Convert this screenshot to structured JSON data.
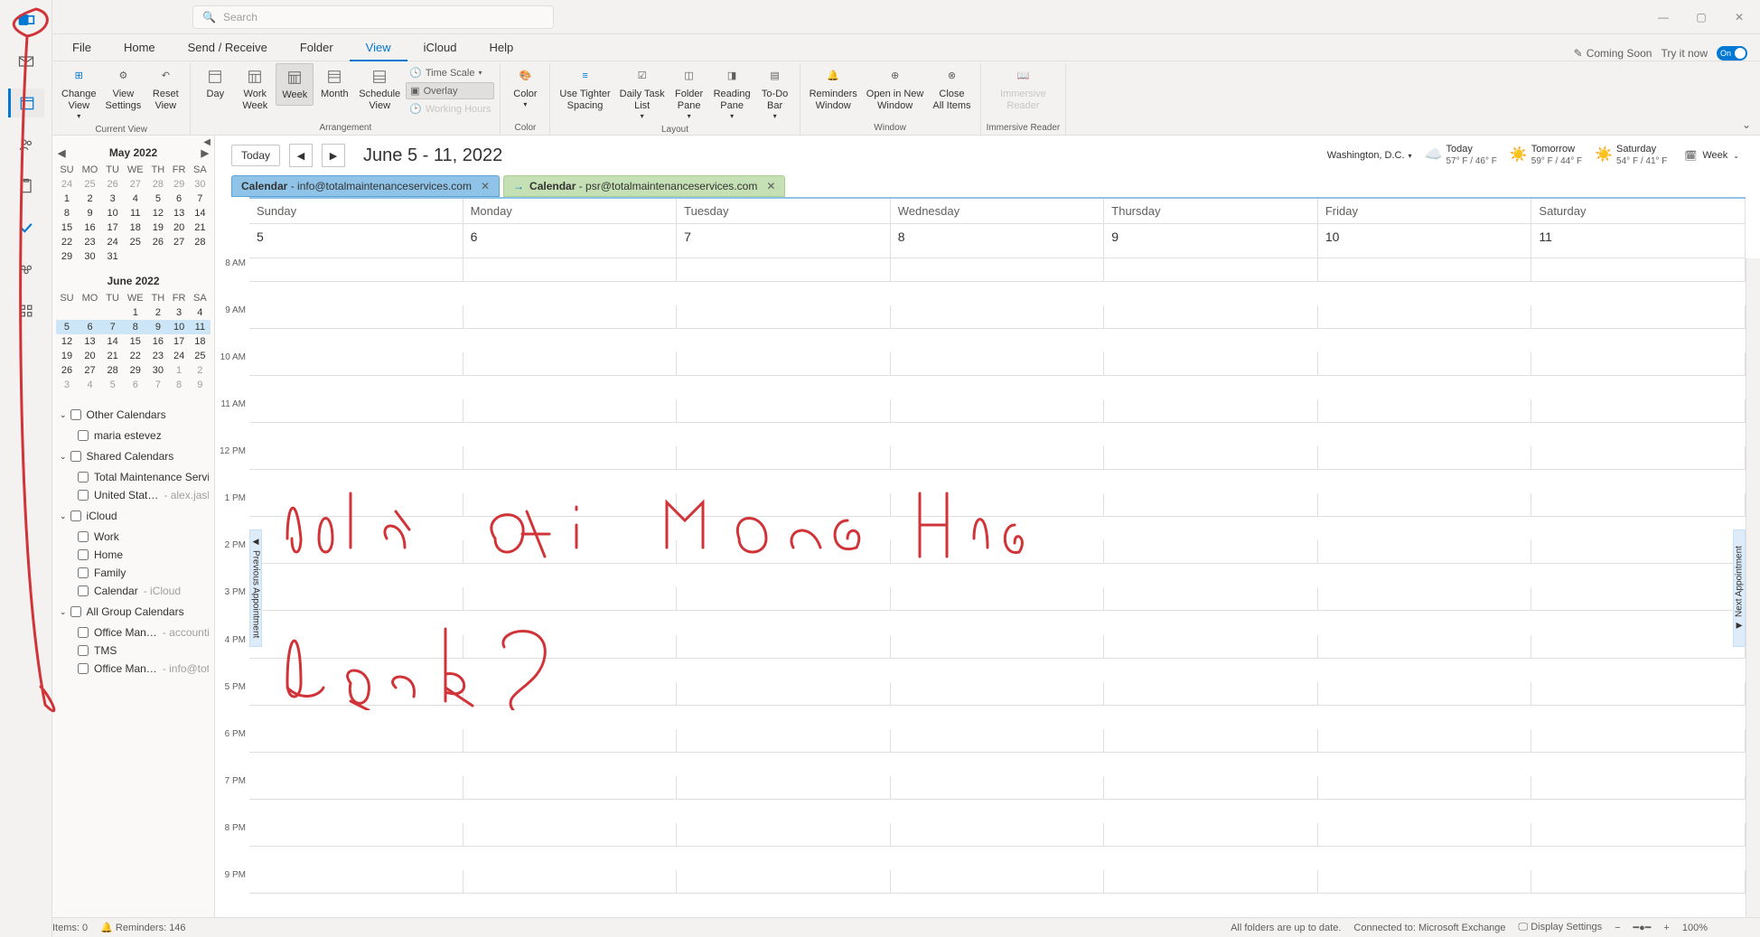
{
  "titlebar": {
    "search_placeholder": "Search"
  },
  "menubar": {
    "items": [
      "File",
      "Home",
      "Send / Receive",
      "Folder",
      "View",
      "iCloud",
      "Help"
    ],
    "active_index": 4,
    "coming_soon": "Coming Soon",
    "try_it_now": "Try it now",
    "toggle_label": "On"
  },
  "ribbon": {
    "groups": {
      "current_view": {
        "label": "Current View",
        "change_view": "Change\nView",
        "view_settings": "View\nSettings",
        "reset_view": "Reset\nView"
      },
      "arrangement": {
        "label": "Arrangement",
        "day": "Day",
        "work_week": "Work\nWeek",
        "week": "Week",
        "month": "Month",
        "schedule_view": "Schedule\nView",
        "time_scale": "Time Scale",
        "overlay": "Overlay",
        "working_hours": "Working Hours"
      },
      "color": {
        "label": "Color",
        "color": "Color"
      },
      "layout": {
        "label": "Layout",
        "tighter_spacing": "Use Tighter\nSpacing",
        "daily_task": "Daily Task\nList",
        "folder_pane": "Folder\nPane",
        "reading_pane": "Reading\nPane",
        "todo_bar": "To-Do\nBar"
      },
      "window": {
        "label": "Window",
        "reminders": "Reminders\nWindow",
        "open_new": "Open in New\nWindow",
        "close_all": "Close\nAll Items"
      },
      "immersive": {
        "label": "Immersive Reader",
        "reader": "Immersive\nReader"
      }
    }
  },
  "nav_rail": {
    "items": [
      {
        "name": "outlook-brand",
        "glyph": "brand"
      },
      {
        "name": "mail",
        "glyph": "mail"
      },
      {
        "name": "calendar",
        "glyph": "calendar",
        "active": true
      },
      {
        "name": "people",
        "glyph": "people"
      },
      {
        "name": "tasks",
        "glyph": "clipboard"
      },
      {
        "name": "todo",
        "glyph": "check"
      },
      {
        "name": "groups",
        "glyph": "group"
      },
      {
        "name": "more",
        "glyph": "grid"
      }
    ]
  },
  "mini_cal": {
    "month1": {
      "title": "May 2022",
      "dow": [
        "SU",
        "MO",
        "TU",
        "WE",
        "TH",
        "FR",
        "SA"
      ],
      "weeks": [
        [
          {
            "d": 24,
            "dim": true
          },
          {
            "d": 25,
            "dim": true
          },
          {
            "d": 26,
            "dim": true
          },
          {
            "d": 27,
            "dim": true
          },
          {
            "d": 28,
            "dim": true
          },
          {
            "d": 29,
            "dim": true
          },
          {
            "d": 30,
            "dim": true
          }
        ],
        [
          {
            "d": 1
          },
          {
            "d": 2
          },
          {
            "d": 3
          },
          {
            "d": 4
          },
          {
            "d": 5
          },
          {
            "d": 6
          },
          {
            "d": 7
          }
        ],
        [
          {
            "d": 8
          },
          {
            "d": 9
          },
          {
            "d": 10
          },
          {
            "d": 11
          },
          {
            "d": 12
          },
          {
            "d": 13
          },
          {
            "d": 14
          }
        ],
        [
          {
            "d": 15
          },
          {
            "d": 16
          },
          {
            "d": 17
          },
          {
            "d": 18
          },
          {
            "d": 19
          },
          {
            "d": 20
          },
          {
            "d": 21
          }
        ],
        [
          {
            "d": 22
          },
          {
            "d": 23
          },
          {
            "d": 24
          },
          {
            "d": 25
          },
          {
            "d": 26
          },
          {
            "d": 27
          },
          {
            "d": 28
          }
        ],
        [
          {
            "d": 29
          },
          {
            "d": 30
          },
          {
            "d": 31
          },
          {
            "d": "",
            "dim": true
          },
          {
            "d": "",
            "dim": true
          },
          {
            "d": "",
            "dim": true
          },
          {
            "d": "",
            "dim": true
          }
        ]
      ]
    },
    "month2": {
      "title": "June 2022",
      "dow": [
        "SU",
        "MO",
        "TU",
        "WE",
        "TH",
        "FR",
        "SA"
      ],
      "weeks": [
        [
          {
            "d": "",
            "dim": true
          },
          {
            "d": "",
            "dim": true
          },
          {
            "d": "",
            "dim": true
          },
          {
            "d": 1
          },
          {
            "d": 2
          },
          {
            "d": 3
          },
          {
            "d": 4
          }
        ],
        [
          {
            "d": 5
          },
          {
            "d": 6
          },
          {
            "d": 7
          },
          {
            "d": 8
          },
          {
            "d": 9
          },
          {
            "d": 10
          },
          {
            "d": 11
          }
        ],
        [
          {
            "d": 12
          },
          {
            "d": 13
          },
          {
            "d": 14
          },
          {
            "d": 15
          },
          {
            "d": 16
          },
          {
            "d": 17
          },
          {
            "d": 18
          }
        ],
        [
          {
            "d": 19
          },
          {
            "d": 20
          },
          {
            "d": 21
          },
          {
            "d": 22
          },
          {
            "d": 23
          },
          {
            "d": 24
          },
          {
            "d": 25
          }
        ],
        [
          {
            "d": 26
          },
          {
            "d": 27
          },
          {
            "d": 28
          },
          {
            "d": 29
          },
          {
            "d": 30
          },
          {
            "d": 1,
            "dim": true
          },
          {
            "d": 2,
            "dim": true
          }
        ],
        [
          {
            "d": 3,
            "dim": true
          },
          {
            "d": 4,
            "dim": true
          },
          {
            "d": 5,
            "dim": true
          },
          {
            "d": 6,
            "dim": true
          },
          {
            "d": 7,
            "dim": true
          },
          {
            "d": 8,
            "dim": true
          },
          {
            "d": 9,
            "dim": true
          }
        ]
      ],
      "selected_week_index": 1
    }
  },
  "tree": {
    "groups": [
      {
        "title": "Other Calendars",
        "items": [
          {
            "label": "maria estevez"
          }
        ]
      },
      {
        "title": "Shared Calendars",
        "items": [
          {
            "label": "Total Maintenance Servi…"
          },
          {
            "label": "United Stat…",
            "sub": " - alex.jaslo…"
          }
        ]
      },
      {
        "title": "iCloud",
        "items": [
          {
            "label": "Work"
          },
          {
            "label": "Home"
          },
          {
            "label": "Family"
          },
          {
            "label": "Calendar",
            "sub": " - iCloud"
          }
        ]
      },
      {
        "title": "All Group Calendars",
        "items": [
          {
            "label": "Office Man…",
            "sub": " - accounti…"
          },
          {
            "label": "TMS"
          },
          {
            "label": "Office Man…",
            "sub": " - info@tot…"
          }
        ]
      }
    ]
  },
  "cal_toolbar": {
    "today": "Today",
    "date_range": "June 5 - 11, 2022",
    "location": "Washington, D.C.",
    "weather": [
      {
        "day": "Today",
        "temp": "57° F / 46° F",
        "icon": "cloud"
      },
      {
        "day": "Tomorrow",
        "temp": "59° F / 44° F",
        "icon": "sun"
      },
      {
        "day": "Saturday",
        "temp": "54° F / 41° F",
        "icon": "sun"
      }
    ],
    "view_label": "Week"
  },
  "cal_tabs": [
    {
      "prefix": "Calendar",
      "email": "info@totalmaintenanceservices.com",
      "type": "primary"
    },
    {
      "prefix": "Calendar",
      "email": "psr@totalmaintenanceservices.com",
      "type": "secondary",
      "arrow": true
    }
  ],
  "day_headers": [
    "Sunday",
    "Monday",
    "Tuesday",
    "Wednesday",
    "Thursday",
    "Friday",
    "Saturday"
  ],
  "day_dates": [
    "5",
    "6",
    "7",
    "8",
    "9",
    "10",
    "11"
  ],
  "time_slots": [
    "8 AM",
    "9 AM",
    "10 AM",
    "11 AM",
    "12 PM",
    "1 PM",
    "2 PM",
    "3 PM",
    "4 PM",
    "5 PM",
    "6 PM",
    "7 PM",
    "8 PM",
    "9 PM"
  ],
  "appt_handles": {
    "prev": "Previous Appointment",
    "next": "Next Appointment"
  },
  "statusbar": {
    "items_label": "Items: 0",
    "reminders": "Reminders: 146",
    "folders_status": "All folders are up to date.",
    "connected": "Connected to: Microsoft Exchange",
    "display": "Display Settings",
    "zoom": "100%"
  }
}
